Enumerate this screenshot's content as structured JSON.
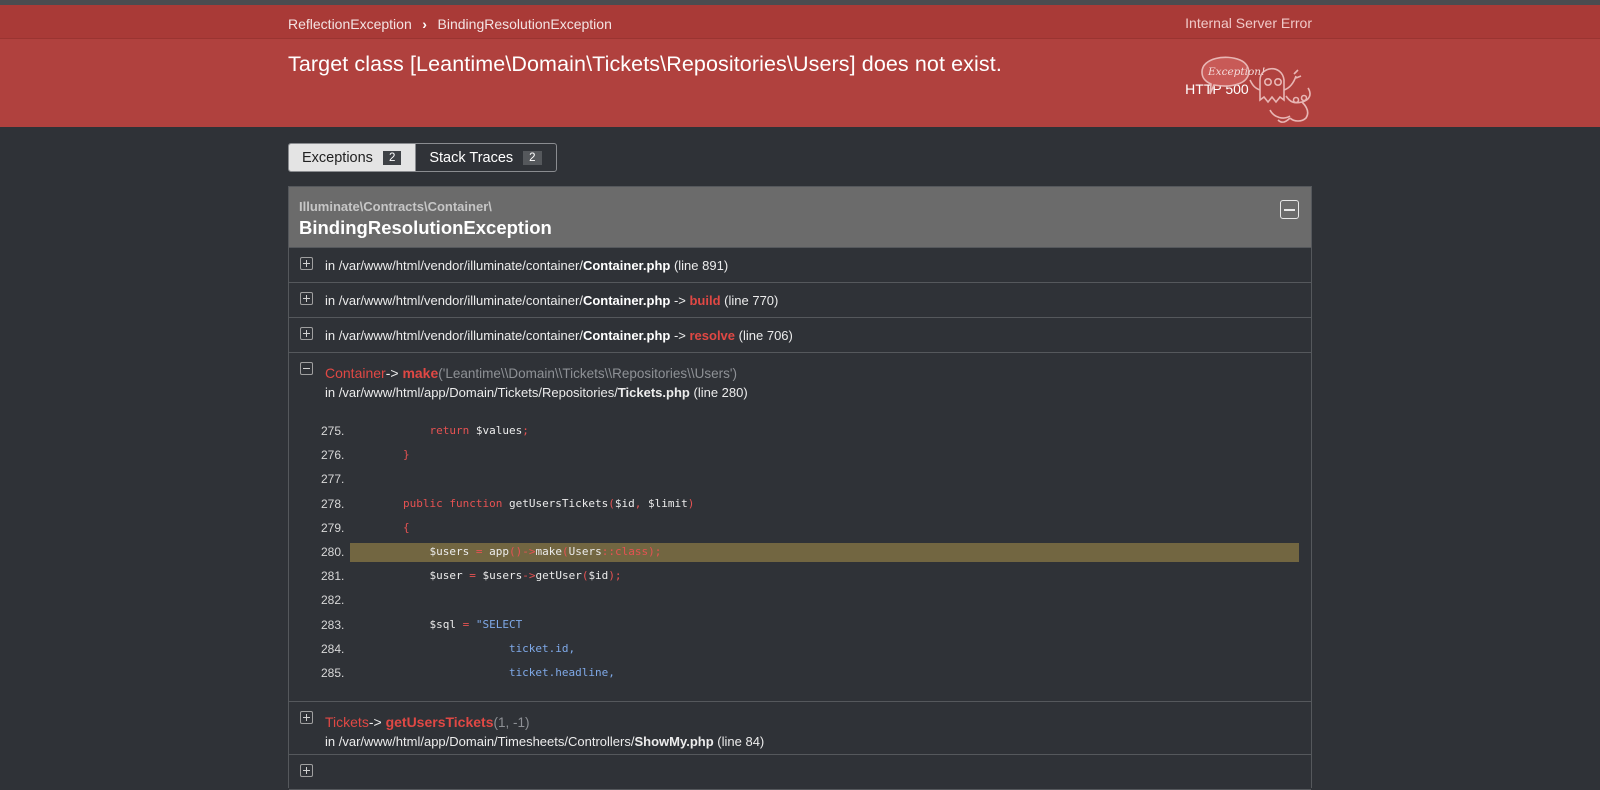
{
  "breadcrumbs": [
    "ReflectionException",
    "BindingResolutionException"
  ],
  "http": {
    "code": "HTTP 500",
    "text": "Internal Server Error"
  },
  "message": "Target class [Leantime\\Domain\\Tickets\\Repositories\\Users] does not exist.",
  "ghost_label": "Exception!",
  "tabs": [
    {
      "label": "Exceptions",
      "count": "2"
    },
    {
      "label": "Stack Traces",
      "count": "2"
    }
  ],
  "exception": {
    "namespace": "Illuminate\\Contracts\\Container\\",
    "class": "BindingResolutionException"
  },
  "frames": [
    {
      "prefix": "in /var/www/html/vendor/illuminate/container/",
      "file": "Container.php",
      "arrow": "",
      "fn": "",
      "line": "(line 891)"
    },
    {
      "prefix": "in /var/www/html/vendor/illuminate/container/",
      "file": "Container.php",
      "arrow": " -> ",
      "fn": "build",
      "line": "(line 770)"
    },
    {
      "prefix": "in /var/www/html/vendor/illuminate/container/",
      "file": "Container.php",
      "arrow": " -> ",
      "fn": "resolve",
      "line": "(line 706)"
    }
  ],
  "open_frame": {
    "class": "Container",
    "arrow": "-> ",
    "fn": "make",
    "args": "('Leantime\\\\Domain\\\\Tickets\\\\Repositories\\\\Users')",
    "prefix": "in /var/www/html/app/Domain/Tickets/Repositories/",
    "file": "Tickets.php",
    "line": "(line 280)"
  },
  "code": [
    {
      "n": "275.",
      "parts": [
        [
          "",
          "            "
        ],
        [
          "kw",
          "return"
        ],
        [
          "",
          " $values"
        ],
        [
          "op",
          ";"
        ]
      ]
    },
    {
      "n": "276.",
      "parts": [
        [
          "",
          "        "
        ],
        [
          "op",
          "}"
        ]
      ]
    },
    {
      "n": "277.",
      "parts": [
        [
          "",
          ""
        ]
      ]
    },
    {
      "n": "278.",
      "parts": [
        [
          "",
          "        "
        ],
        [
          "kw",
          "public function"
        ],
        [
          "",
          " getUsersTickets"
        ],
        [
          "op",
          "("
        ],
        [
          "",
          "$id"
        ],
        [
          "op",
          ","
        ],
        [
          "",
          " $limit"
        ],
        [
          "op",
          ")"
        ]
      ]
    },
    {
      "n": "279.",
      "parts": [
        [
          "",
          "        "
        ],
        [
          "op",
          "{"
        ]
      ]
    },
    {
      "n": "280.",
      "highlight": true,
      "parts": [
        [
          "",
          "            $users "
        ],
        [
          "op",
          "="
        ],
        [
          "",
          " app"
        ],
        [
          "op",
          "()->"
        ],
        [
          "",
          "make"
        ],
        [
          "op",
          "("
        ],
        [
          "",
          "Users"
        ],
        [
          "op",
          "::class);"
        ]
      ]
    },
    {
      "n": "281.",
      "parts": [
        [
          "",
          "            $user "
        ],
        [
          "op",
          "="
        ],
        [
          "",
          " $users"
        ],
        [
          "op",
          "->"
        ],
        [
          "",
          "getUser"
        ],
        [
          "op",
          "("
        ],
        [
          "",
          "$id"
        ],
        [
          "op",
          ");"
        ]
      ]
    },
    {
      "n": "282.",
      "parts": [
        [
          "",
          ""
        ]
      ]
    },
    {
      "n": "283.",
      "parts": [
        [
          "",
          "            $sql "
        ],
        [
          "op",
          "="
        ],
        [
          "str",
          " \"SELECT"
        ]
      ]
    },
    {
      "n": "284.",
      "parts": [
        [
          "str",
          "                        ticket.id,"
        ]
      ]
    },
    {
      "n": "285.",
      "parts": [
        [
          "str",
          "                        ticket.headline,"
        ]
      ]
    }
  ],
  "frame2": {
    "class": "Tickets",
    "arrow": "-> ",
    "fn": "getUsersTickets",
    "args": "(1, -1)",
    "prefix": "in /var/www/html/app/Domain/Timesheets/Controllers/",
    "file": "ShowMy.php",
    "line": "(line 84)"
  }
}
